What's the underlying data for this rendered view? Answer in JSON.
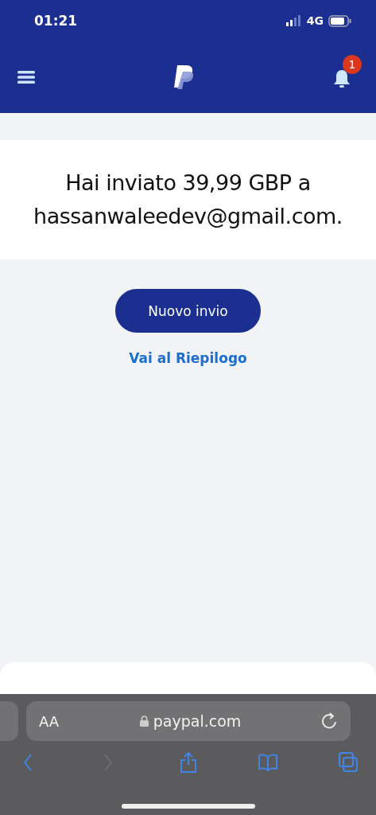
{
  "status_bar": {
    "time": "01:21",
    "network": "4G"
  },
  "header": {
    "notification_badge": "1"
  },
  "confirmation": {
    "message": "Hai inviato 39,99 GBP a hassanwaleedev@gmail.com."
  },
  "actions": {
    "primary_button": "Nuovo invio",
    "link": "Vai al Riepilogo"
  },
  "browser": {
    "text_size_button": "AA",
    "url": "paypal.com",
    "nav": [
      {
        "kind": "back",
        "disabled": false
      },
      {
        "kind": "forward",
        "disabled": true
      },
      {
        "kind": "share",
        "disabled": false
      },
      {
        "kind": "bookmarks",
        "disabled": false
      },
      {
        "kind": "tabs",
        "disabled": false
      }
    ]
  }
}
